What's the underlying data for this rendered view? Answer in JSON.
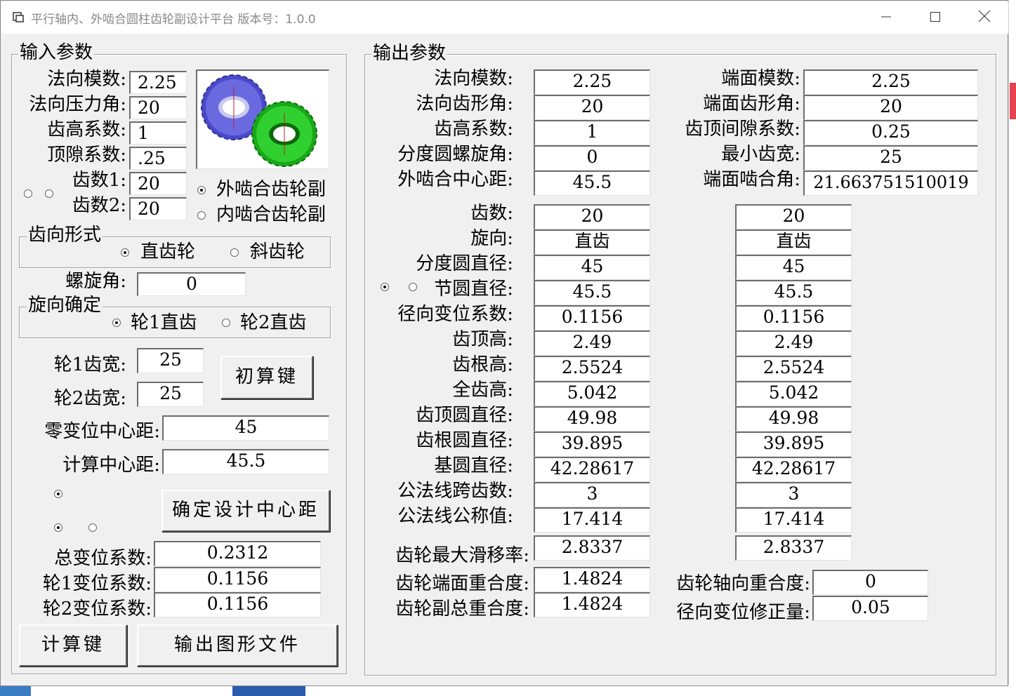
{
  "window": {
    "title": "平行轴内、外啮合圆柱齿轮副设计平台 版本号：1.0.0"
  },
  "input": {
    "legend": "输入参数",
    "normal_module_label": "法向模数:",
    "normal_module": "2.25",
    "pressure_angle_label": "法向压力角:",
    "pressure_angle": "20",
    "addendum_coef_label": "齿高系数:",
    "addendum_coef": "1",
    "clearance_coef_label": "顶隙系数:",
    "clearance_coef": ".25",
    "teeth1_label": "齿数1:",
    "teeth1": "20",
    "teeth2_label": "齿数2:",
    "teeth2": "20",
    "external_mesh_label": "外啮合齿轮副",
    "internal_mesh_label": "内啮合齿轮副",
    "tooth_form_legend": "齿向形式",
    "spur_label": "直齿轮",
    "helical_label": "斜齿轮",
    "helix_angle_label": "螺旋角:",
    "helix_angle": "0",
    "hand_legend": "旋向确定",
    "wheel1_straight_label": "轮1直齿",
    "wheel2_straight_label": "轮2直齿",
    "width1_label": "轮1齿宽:",
    "width1": "25",
    "width2_label": "轮2齿宽:",
    "width2": "25",
    "precalc_button": "初算键",
    "zero_shift_center_label": "零变位中心距:",
    "zero_shift_center": "45",
    "calc_center_label": "计算中心距:",
    "calc_center": "45.5",
    "confirm_center_button": "确定设计中心距",
    "total_shift_label": "总变位系数:",
    "total_shift": "0.2312",
    "shift1_label": "轮1变位系数:",
    "shift1": "0.1156",
    "shift2_label": "轮2变位系数:",
    "shift2": "0.1156",
    "calc_button": "计算键",
    "export_button": "输出图形文件"
  },
  "output": {
    "legend": "输出参数",
    "normal_module_label": "法向模数:",
    "normal_module": "2.25",
    "normal_profile_angle_label": "法向齿形角:",
    "normal_profile_angle": "20",
    "addendum_coef_label": "齿高系数:",
    "addendum_coef": "1",
    "helix_angle_label": "分度圆螺旋角:",
    "helix_angle": "0",
    "center_label": "外啮合中心距:",
    "center": "45.5",
    "transverse_module_label": "端面模数:",
    "transverse_module": "2.25",
    "transverse_profile_angle_label": "端面齿形角:",
    "transverse_profile_angle": "20",
    "clearance_coef_label": "齿顶间隙系数:",
    "clearance_coef": "0.25",
    "min_width_label": "最小齿宽:",
    "min_width": "25",
    "transverse_mesh_angle_label": "端面啮合角:",
    "transverse_mesh_angle": "21.663751510019",
    "rows": [
      {
        "label": "齿数:",
        "g1": "20",
        "g2": "20"
      },
      {
        "label": "旋向:",
        "g1": "直齿",
        "g2": "直齿"
      },
      {
        "label": "分度圆直径:",
        "g1": "45",
        "g2": "45"
      },
      {
        "label": "节圆直径:",
        "g1": "45.5",
        "g2": "45.5"
      },
      {
        "label": "径向变位系数:",
        "g1": "0.1156",
        "g2": "0.1156"
      },
      {
        "label": "齿顶高:",
        "g1": "2.49",
        "g2": "2.49"
      },
      {
        "label": "齿根高:",
        "g1": "2.5524",
        "g2": "2.5524"
      },
      {
        "label": "全齿高:",
        "g1": "5.042",
        "g2": "5.042"
      },
      {
        "label": "齿顶圆直径:",
        "g1": "49.98",
        "g2": "49.98"
      },
      {
        "label": "齿根圆直径:",
        "g1": "39.895",
        "g2": "39.895"
      },
      {
        "label": "基圆直径:",
        "g1": "42.28617",
        "g2": "42.28617"
      },
      {
        "label": "公法线跨齿数:",
        "g1": "3",
        "g2": "3"
      },
      {
        "label": "公法线公称值:",
        "g1": "17.414",
        "g2": "17.414"
      }
    ],
    "max_slip_label": "齿轮最大滑移率:",
    "max_slip1": "2.8337",
    "max_slip2": "2.8337",
    "transverse_contact_label": "齿轮端面重合度:",
    "transverse_contact": "1.4824",
    "total_contact_label": "齿轮副总重合度:",
    "total_contact": "1.4824",
    "axial_contact_label": "齿轮轴向重合度:",
    "axial_contact": "0",
    "radial_shift_corr_label": "径向变位修正量:",
    "radial_shift_corr": "0.05"
  },
  "colors": {
    "gear1": "#5b5bd6",
    "gear2": "#22c022",
    "accent_bar": "#e8414f"
  }
}
